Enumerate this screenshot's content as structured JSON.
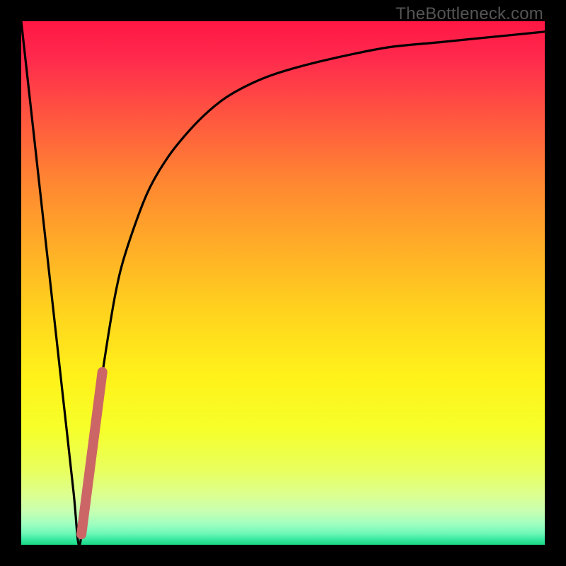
{
  "watermark": "TheBottleneck.com",
  "colors": {
    "black": "#000000",
    "curve": "#000000",
    "pink_segment": "#cc6666",
    "gradient_stops": [
      {
        "offset": 0.0,
        "color": "#ff1744"
      },
      {
        "offset": 0.07,
        "color": "#ff2a4d"
      },
      {
        "offset": 0.18,
        "color": "#ff5540"
      },
      {
        "offset": 0.3,
        "color": "#ff8432"
      },
      {
        "offset": 0.42,
        "color": "#ffaa28"
      },
      {
        "offset": 0.55,
        "color": "#ffd21e"
      },
      {
        "offset": 0.68,
        "color": "#fff21a"
      },
      {
        "offset": 0.78,
        "color": "#f6ff2a"
      },
      {
        "offset": 0.86,
        "color": "#e8ff60"
      },
      {
        "offset": 0.905,
        "color": "#dcff90"
      },
      {
        "offset": 0.935,
        "color": "#c8ffb0"
      },
      {
        "offset": 0.96,
        "color": "#a0ffc0"
      },
      {
        "offset": 0.978,
        "color": "#70f8b8"
      },
      {
        "offset": 0.99,
        "color": "#38e8a0"
      },
      {
        "offset": 1.0,
        "color": "#18d884"
      }
    ]
  },
  "chart_data": {
    "type": "line",
    "title": "",
    "xlabel": "",
    "ylabel": "",
    "xlim": [
      0,
      100
    ],
    "ylim": [
      0,
      100
    ],
    "series": [
      {
        "name": "bottleneck-curve",
        "x": [
          0,
          2,
          4,
          6,
          8,
          10,
          11,
          12,
          14,
          16,
          18,
          20,
          24,
          28,
          32,
          36,
          40,
          46,
          52,
          60,
          70,
          80,
          90,
          100
        ],
        "y": [
          100,
          82,
          64,
          46,
          28,
          10,
          0,
          6,
          22,
          36,
          48,
          56,
          67,
          74,
          79,
          83,
          86,
          89,
          91,
          93,
          95,
          96,
          97,
          98
        ]
      }
    ],
    "highlight_segment": {
      "name": "pink-segment",
      "x": [
        11.5,
        15.5
      ],
      "y": [
        2,
        33
      ]
    },
    "notes": "V-shaped bottleneck curve on red→green vertical gradient background. Values are estimated from pixel positions; y=0 at bottom (green), y=100 at top (red)."
  }
}
